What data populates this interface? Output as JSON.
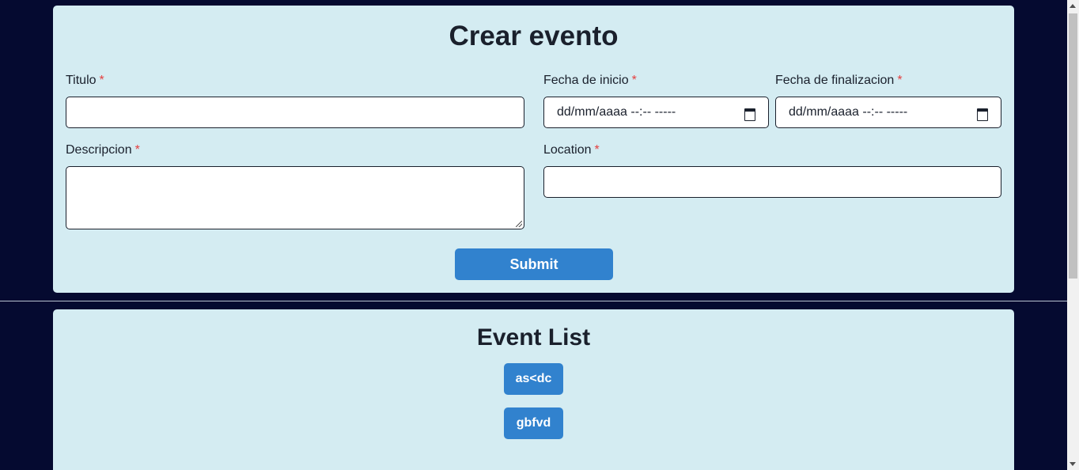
{
  "create_form": {
    "title": "Crear evento",
    "required_marker": "*",
    "titulo_label": "Titulo",
    "titulo_value": "",
    "fecha_inicio_label": "Fecha de inicio",
    "fecha_inicio_placeholder": "dd/mm/aaaa --:-- -----",
    "fecha_fin_label": "Fecha de finalizacion",
    "fecha_fin_placeholder": "dd/mm/aaaa --:-- -----",
    "descripcion_label": "Descripcion",
    "descripcion_value": "",
    "location_label": "Location",
    "location_value": "",
    "submit_label": "Submit"
  },
  "event_list": {
    "title": "Event List",
    "events": [
      {
        "label": "as<dc"
      },
      {
        "label": "gbfvd"
      }
    ]
  },
  "icons": {
    "calendar": "calendar-icon"
  },
  "colors": {
    "background": "#050a30",
    "card": "#d4ecf2",
    "button": "#3182ce",
    "required": "#e53e3e"
  }
}
